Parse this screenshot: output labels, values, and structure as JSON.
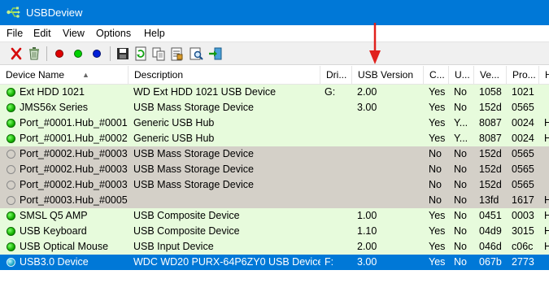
{
  "window": {
    "title": "USBDeview"
  },
  "menu": [
    "File",
    "Edit",
    "View",
    "Options",
    "Help"
  ],
  "toolbar": {
    "buttons": [
      "disconnect-icon",
      "uninstall-icon",
      "red-dot-icon",
      "green-dot-icon",
      "blue-dot-icon",
      "save-icon",
      "refresh-icon",
      "copy-icon",
      "properties-icon",
      "find-icon",
      "exit-icon"
    ]
  },
  "columns": [
    "Device Name",
    "Description",
    "Dri...",
    "USB Version",
    "C...",
    "U...",
    "Ve...",
    "Pro...",
    "H"
  ],
  "colors": {
    "titlebar": "#0078d7",
    "connected_row": "#e7fbdc",
    "disconnected_row": "#d4d0c8",
    "selected_row": "#0078d7",
    "annotation_arrow": "#e0211d"
  },
  "rows": [
    {
      "state": "connected",
      "device_name": "Ext HDD 1021",
      "description": "WD Ext HDD 1021 USB Device",
      "drive": "G:",
      "usb_version": "2.00",
      "connected": "Yes",
      "u": "No",
      "vendor": "1058",
      "product": "1021",
      "h": ""
    },
    {
      "state": "connected",
      "device_name": "JMS56x Series",
      "description": "USB Mass Storage Device",
      "drive": "",
      "usb_version": "3.00",
      "connected": "Yes",
      "u": "No",
      "vendor": "152d",
      "product": "0565",
      "h": ""
    },
    {
      "state": "connected",
      "device_name": "Port_#0001.Hub_#0001",
      "description": "Generic USB Hub",
      "drive": "",
      "usb_version": "",
      "connected": "Yes",
      "u": "Y...",
      "vendor": "8087",
      "product": "0024",
      "h": "H"
    },
    {
      "state": "connected",
      "device_name": "Port_#0001.Hub_#0002",
      "description": "Generic USB Hub",
      "drive": "",
      "usb_version": "",
      "connected": "Yes",
      "u": "Y...",
      "vendor": "8087",
      "product": "0024",
      "h": "H"
    },
    {
      "state": "disconnected",
      "device_name": "Port_#0002.Hub_#0003",
      "description": "USB Mass Storage Device",
      "drive": "",
      "usb_version": "",
      "connected": "No",
      "u": "No",
      "vendor": "152d",
      "product": "0565",
      "h": ""
    },
    {
      "state": "disconnected",
      "device_name": "Port_#0002.Hub_#0003",
      "description": "USB Mass Storage Device",
      "drive": "",
      "usb_version": "",
      "connected": "No",
      "u": "No",
      "vendor": "152d",
      "product": "0565",
      "h": ""
    },
    {
      "state": "disconnected",
      "device_name": "Port_#0002.Hub_#0003",
      "description": "USB Mass Storage Device",
      "drive": "",
      "usb_version": "",
      "connected": "No",
      "u": "No",
      "vendor": "152d",
      "product": "0565",
      "h": ""
    },
    {
      "state": "disconnected",
      "device_name": "Port_#0003.Hub_#0005",
      "description": "",
      "drive": "",
      "usb_version": "",
      "connected": "No",
      "u": "No",
      "vendor": "13fd",
      "product": "1617",
      "h": "H"
    },
    {
      "state": "connected",
      "device_name": "SMSL Q5 AMP",
      "description": "USB Composite Device",
      "drive": "",
      "usb_version": "1.00",
      "connected": "Yes",
      "u": "No",
      "vendor": "0451",
      "product": "0003",
      "h": "H"
    },
    {
      "state": "connected",
      "device_name": "USB Keyboard",
      "description": "USB Composite Device",
      "drive": "",
      "usb_version": "1.10",
      "connected": "Yes",
      "u": "No",
      "vendor": "04d9",
      "product": "3015",
      "h": "H"
    },
    {
      "state": "connected",
      "device_name": "USB Optical Mouse",
      "description": "USB Input Device",
      "drive": "",
      "usb_version": "2.00",
      "connected": "Yes",
      "u": "No",
      "vendor": "046d",
      "product": "c06c",
      "h": "H"
    },
    {
      "state": "selected",
      "device_name": "USB3.0 Device",
      "description": "WDC WD20 PURX-64P6ZY0 USB Device",
      "drive": "F:",
      "usb_version": "3.00",
      "connected": "Yes",
      "u": "No",
      "vendor": "067b",
      "product": "2773",
      "h": ""
    }
  ]
}
